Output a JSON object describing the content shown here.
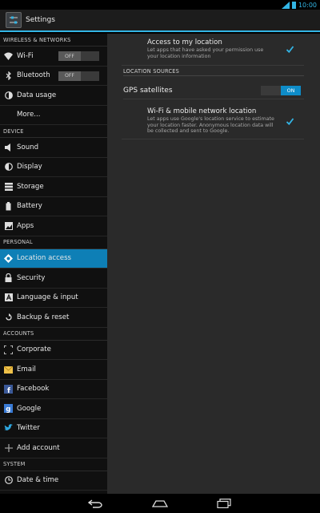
{
  "status": {
    "time": "10:00"
  },
  "app": {
    "title": "Settings"
  },
  "categories": {
    "wireless": "WIRELESS & NETWORKS",
    "device": "DEVICE",
    "personal": "PERSONAL",
    "accounts": "ACCOUNTS",
    "system": "SYSTEM"
  },
  "menu": {
    "wifi": {
      "label": "Wi-Fi",
      "toggle": "OFF"
    },
    "bluetooth": {
      "label": "Bluetooth",
      "toggle": "OFF"
    },
    "data_usage": "Data usage",
    "more": "More...",
    "sound": "Sound",
    "display": "Display",
    "storage": "Storage",
    "battery": "Battery",
    "apps": "Apps",
    "location": "Location access",
    "security": "Security",
    "language": "Language & input",
    "backup": "Backup & reset",
    "corporate": "Corporate",
    "email": "Email",
    "facebook": "Facebook",
    "google": "Google",
    "twitter": "Twitter",
    "add_account": "Add account",
    "date_time": "Date & time"
  },
  "detail": {
    "access": {
      "title": "Access to my location",
      "summary": "Let apps that have asked your permission use your location information",
      "checked": true
    },
    "sources_header": "LOCATION SOURCES",
    "gps": {
      "title": "GPS satellites",
      "toggle": "ON"
    },
    "wifi_location": {
      "title": "Wi-Fi & mobile network location",
      "summary": "Let apps use Google's location service to estimate your location faster. Anonymous location data will be collected and sent to Google.",
      "checked": true
    }
  },
  "colors": {
    "accent": "#33b5e5",
    "selected": "#0e7fb6"
  }
}
